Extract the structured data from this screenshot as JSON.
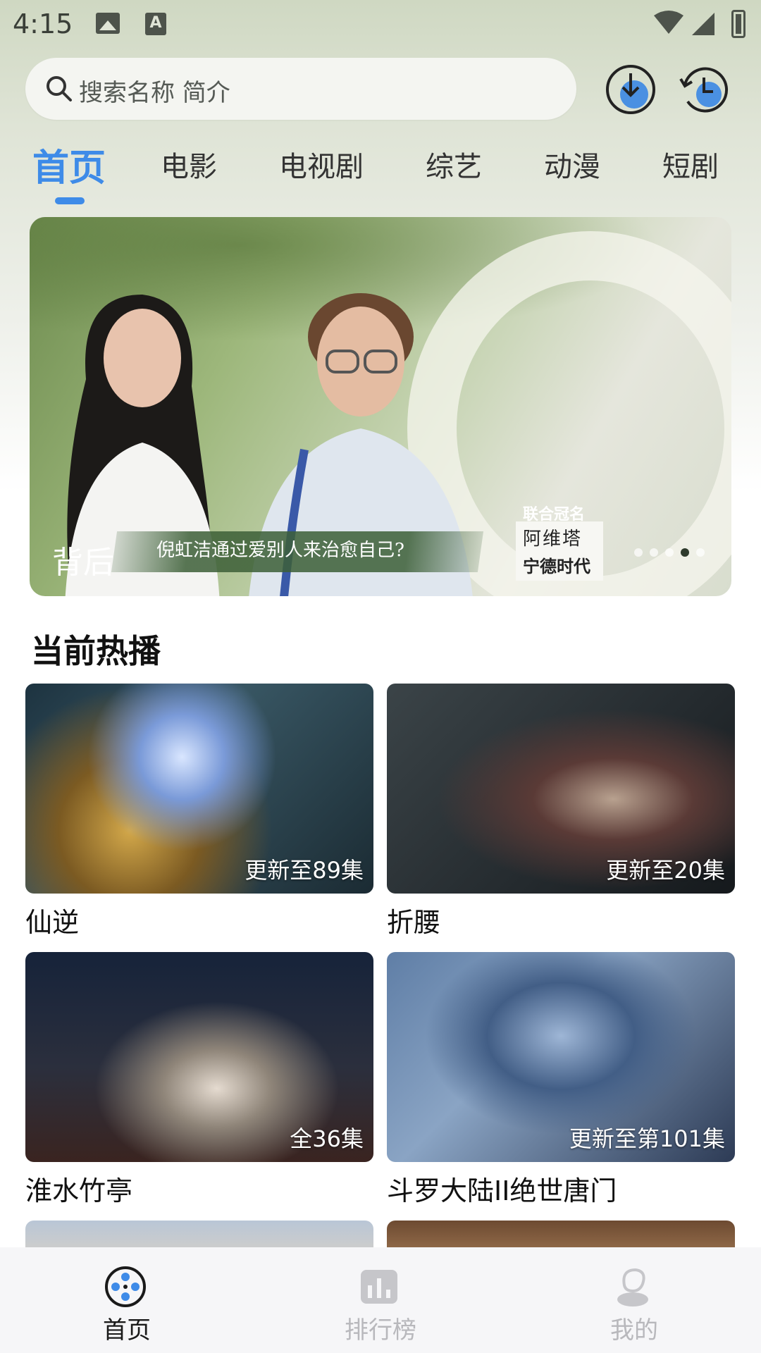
{
  "status_bar": {
    "time": "4:15"
  },
  "search": {
    "placeholder": "搜索名称 简介"
  },
  "tabs": [
    {
      "label": "首页",
      "active": true
    },
    {
      "label": "电影"
    },
    {
      "label": "电视剧"
    },
    {
      "label": "综艺"
    },
    {
      "label": "动漫"
    },
    {
      "label": "短剧"
    }
  ],
  "banner": {
    "title": "背后",
    "caption": "倪虹洁通过爱别人来治愈自己?",
    "sponsor_label": "联合冠名",
    "sponsor_line1": "阿维塔",
    "sponsor_line2": "宁德时代",
    "slide_count": 5,
    "active_slide": 4
  },
  "section": {
    "title": "当前热播"
  },
  "cards": [
    {
      "title": "仙逆",
      "badge": "更新至89集"
    },
    {
      "title": "折腰",
      "badge": "更新至20集"
    },
    {
      "title": "淮水竹亭",
      "badge": "全36集"
    },
    {
      "title": "斗罗大陆II绝世唐门",
      "badge": "更新至第101集"
    }
  ],
  "bottom_nav": [
    {
      "label": "首页",
      "icon": "film-reel-icon",
      "active": true
    },
    {
      "label": "排行榜",
      "icon": "ranking-chart-icon"
    },
    {
      "label": "我的",
      "icon": "profile-icon"
    }
  ],
  "colors": {
    "accent": "#3e8be8"
  }
}
